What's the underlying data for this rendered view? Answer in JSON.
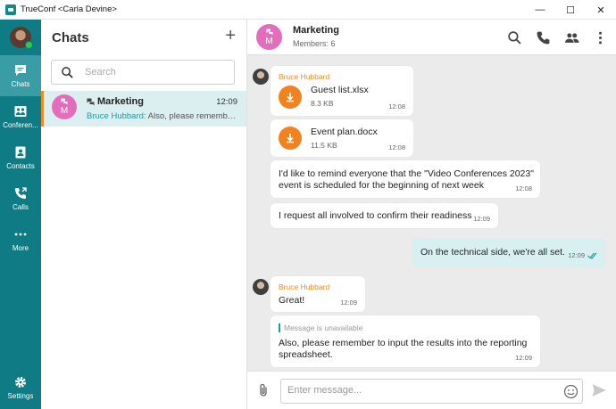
{
  "window": {
    "title": "TrueConf <Carla Devine>",
    "controls": [
      "—",
      "☐",
      "✕"
    ]
  },
  "rail": {
    "items": [
      {
        "label": "Chats",
        "icon": "chat-icon"
      },
      {
        "label": "Conferen...",
        "icon": "conference-icon"
      },
      {
        "label": "Contacts",
        "icon": "contacts-icon"
      },
      {
        "label": "Calls",
        "icon": "calls-icon"
      },
      {
        "label": "More",
        "icon": "more-dots-icon"
      }
    ],
    "settings_label": "Settings"
  },
  "chat_list": {
    "title": "Chats",
    "add_label": "+",
    "search_placeholder": "Search",
    "chats": [
      {
        "name": "Marketing",
        "avatar_letter": "M",
        "time": "12:09",
        "preview_sender": "Bruce Hubbard:",
        "preview_text": " Also, please remember to input the results into the reporting spreadsheet."
      }
    ]
  },
  "conversation": {
    "name": "Marketing",
    "members": "Members: 6",
    "avatar_letter": "M",
    "messages": [
      {
        "sender": "Bruce Hubbard",
        "file_name": "Guest list.xlsx",
        "file_size": "8.3 KB",
        "time": "12:08"
      },
      {
        "file_name": "Event plan.docx",
        "file_size": "11.5 KB",
        "time": "12:08"
      },
      {
        "text_line1": "I'd like to remind everyone that the \"Video Conferences 2023\"",
        "text_line2": "event is scheduled for the beginning of next week",
        "time": "12:08"
      },
      {
        "text": "I request all involved to confirm their readiness",
        "time": "12:09"
      },
      {
        "text": "On the technical side, we're all set.",
        "time": "12:09",
        "outgoing": true
      },
      {
        "sender": "Bruce Hubbard",
        "text": "Great!",
        "time": "12:09"
      },
      {
        "quote": "Message is unavailable",
        "text_line1": "Also, please remember to input the results into the reporting",
        "text_line2": "spreadsheet.",
        "time": "12:09"
      }
    ]
  },
  "composer": {
    "placeholder": "Enter message..."
  },
  "colors": {
    "rail": "#0f7c85",
    "rail_active": "#3a9ca4",
    "accent_orange": "#f08a24",
    "avatar_pink": "#e46cbb",
    "outgoing_bubble": "#d9f0f2",
    "selected_chat": "#dbeef0"
  }
}
